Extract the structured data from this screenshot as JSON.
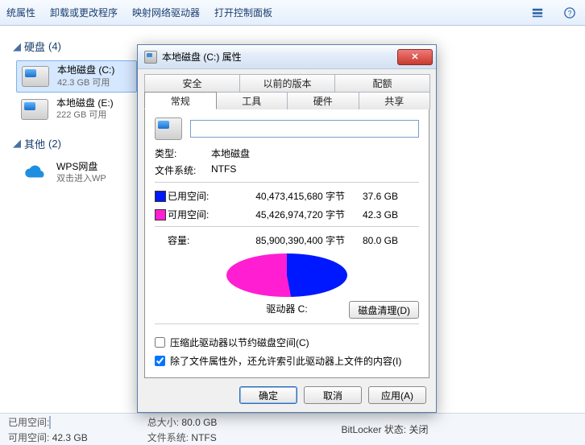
{
  "toolbar": {
    "sys_props": "统属性",
    "uninstall": "卸载或更改程序",
    "map_drive": "映射网络驱动器",
    "open_cp": "打开控制面板"
  },
  "sections": {
    "hdd": {
      "label": "硬盘",
      "count": "(4)"
    },
    "other": {
      "label": "其他",
      "count": "(2)"
    }
  },
  "drives": {
    "c": {
      "name": "本地磁盘 (C:)",
      "sub": "42.3 GB 可用"
    },
    "e": {
      "name": "本地磁盘 (E:)",
      "sub": "222 GB 可用"
    },
    "wps": {
      "name": "WPS网盘",
      "sub": "双击进入WP"
    }
  },
  "status": {
    "used_lbl": "已用空间:",
    "free_lbl": "可用空间:",
    "free_val": "42.3 GB",
    "size_lbl": "总大小:",
    "size_val": "80.0 GB",
    "fs_lbl": "文件系统:",
    "fs_val": "NTFS",
    "bitlocker": "BitLocker 状态: 关闭"
  },
  "dialog": {
    "title": "本地磁盘 (C:) 属性",
    "tabs": {
      "security": "安全",
      "prev": "以前的版本",
      "quota": "配额",
      "general": "常规",
      "tools": "工具",
      "hardware": "硬件",
      "sharing": "共享"
    },
    "name_value": "",
    "type_lbl": "类型:",
    "type_val": "本地磁盘",
    "fs_lbl": "文件系统:",
    "fs_val": "NTFS",
    "used_lbl": "已用空间:",
    "used_bytes": "40,473,415,680 字节",
    "used_gb": "37.6 GB",
    "free_lbl": "可用空间:",
    "free_bytes": "45,426,974,720 字节",
    "free_gb": "42.3 GB",
    "cap_lbl": "容量:",
    "cap_bytes": "85,900,390,400 字节",
    "cap_gb": "80.0 GB",
    "pie_label": "驱动器 C:",
    "cleanup_btn": "磁盘清理(D)",
    "compress_chk": "压缩此驱动器以节约磁盘空间(C)",
    "index_chk": "除了文件属性外，还允许索引此驱动器上文件的内容(I)",
    "ok": "确定",
    "cancel": "取消",
    "apply": "应用(A)"
  },
  "chart_data": {
    "type": "pie",
    "title": "驱动器 C:",
    "series": [
      {
        "name": "已用空间",
        "value": 40473415680,
        "display": "37.6 GB",
        "color": "#0018ff"
      },
      {
        "name": "可用空间",
        "value": 45426974720,
        "display": "42.3 GB",
        "color": "#ff1ed2"
      }
    ],
    "total": {
      "name": "容量",
      "value": 85900390400,
      "display": "80.0 GB"
    }
  }
}
